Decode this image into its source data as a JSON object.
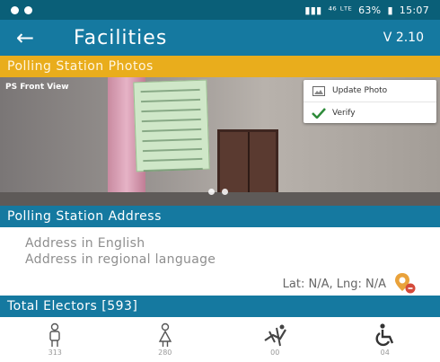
{
  "status_bar": {
    "network": "⁴⁶ ᴸᵀᴱ",
    "battery": "63%",
    "time": "15:07"
  },
  "app_bar": {
    "title": "Facilities",
    "version": "V 2.10"
  },
  "photos_section": {
    "title": "Polling Station Photos",
    "photo_label": "PS Front View",
    "menu": {
      "update_photo": "Update Photo",
      "verify": "Verify"
    }
  },
  "address_section": {
    "title": "Polling Station Address",
    "address_english": "Address in English",
    "address_regional": "Address in regional language",
    "lat_lng": "Lat: N/A, Lng: N/A"
  },
  "electors_section": {
    "title": "Total Electors [593]",
    "items": [
      {
        "icon": "male-icon",
        "count": "313"
      },
      {
        "icon": "female-icon",
        "count": "280"
      },
      {
        "icon": "third-gender-icon",
        "count": "00"
      },
      {
        "icon": "wheelchair-icon",
        "count": "04"
      }
    ]
  },
  "colors": {
    "primary": "#1579a0",
    "status_bar": "#0a5f78",
    "accent": "#e9ad1c",
    "verify_check": "#2e8b3a",
    "pin": "#e9a23b"
  }
}
